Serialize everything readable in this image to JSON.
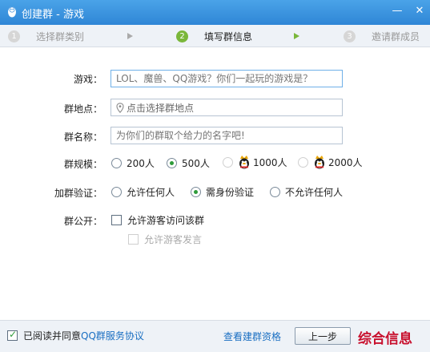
{
  "window": {
    "title": "创建群 - 游戏",
    "minimize_glyph": "—",
    "close_glyph": "✕"
  },
  "steps": [
    {
      "num": "1",
      "label": "选择群类别"
    },
    {
      "num": "2",
      "label": "填写群信息"
    },
    {
      "num": "3",
      "label": "邀请群成员"
    }
  ],
  "form": {
    "game": {
      "label": "游戏：",
      "placeholder": "LOL、魔兽、QQ游戏？你们一起玩的游戏是？"
    },
    "location": {
      "label": "群地点：",
      "placeholder": "点击选择群地点"
    },
    "name": {
      "label": "群名称：",
      "placeholder": "为你们的群取个给力的名字吧!"
    },
    "size": {
      "label": "群规模：",
      "options": [
        "200人",
        "500人",
        "1000人",
        "2000人"
      ],
      "selected": "500人"
    },
    "verify": {
      "label": "加群验证：",
      "options": [
        "允许任何人",
        "需身份验证",
        "不允许任何人"
      ],
      "selected": "需身份验证"
    },
    "public": {
      "label": "群公开：",
      "allow_visitor": "允许游客访问该群",
      "allow_visitor_speak": "允许游客发言"
    }
  },
  "footer": {
    "agree_prefix": "已阅读并同意",
    "agree_link": "QQ群服务协议",
    "view_qualification": "查看建群资格",
    "prev_button": "上一步",
    "watermark": "综合信息"
  },
  "colors": {
    "titlebar": "#2f86d6",
    "step_active": "#7ab73a",
    "link": "#1a6fc2",
    "radio_checked": "#2e9b3a",
    "watermark": "#c8102e"
  }
}
